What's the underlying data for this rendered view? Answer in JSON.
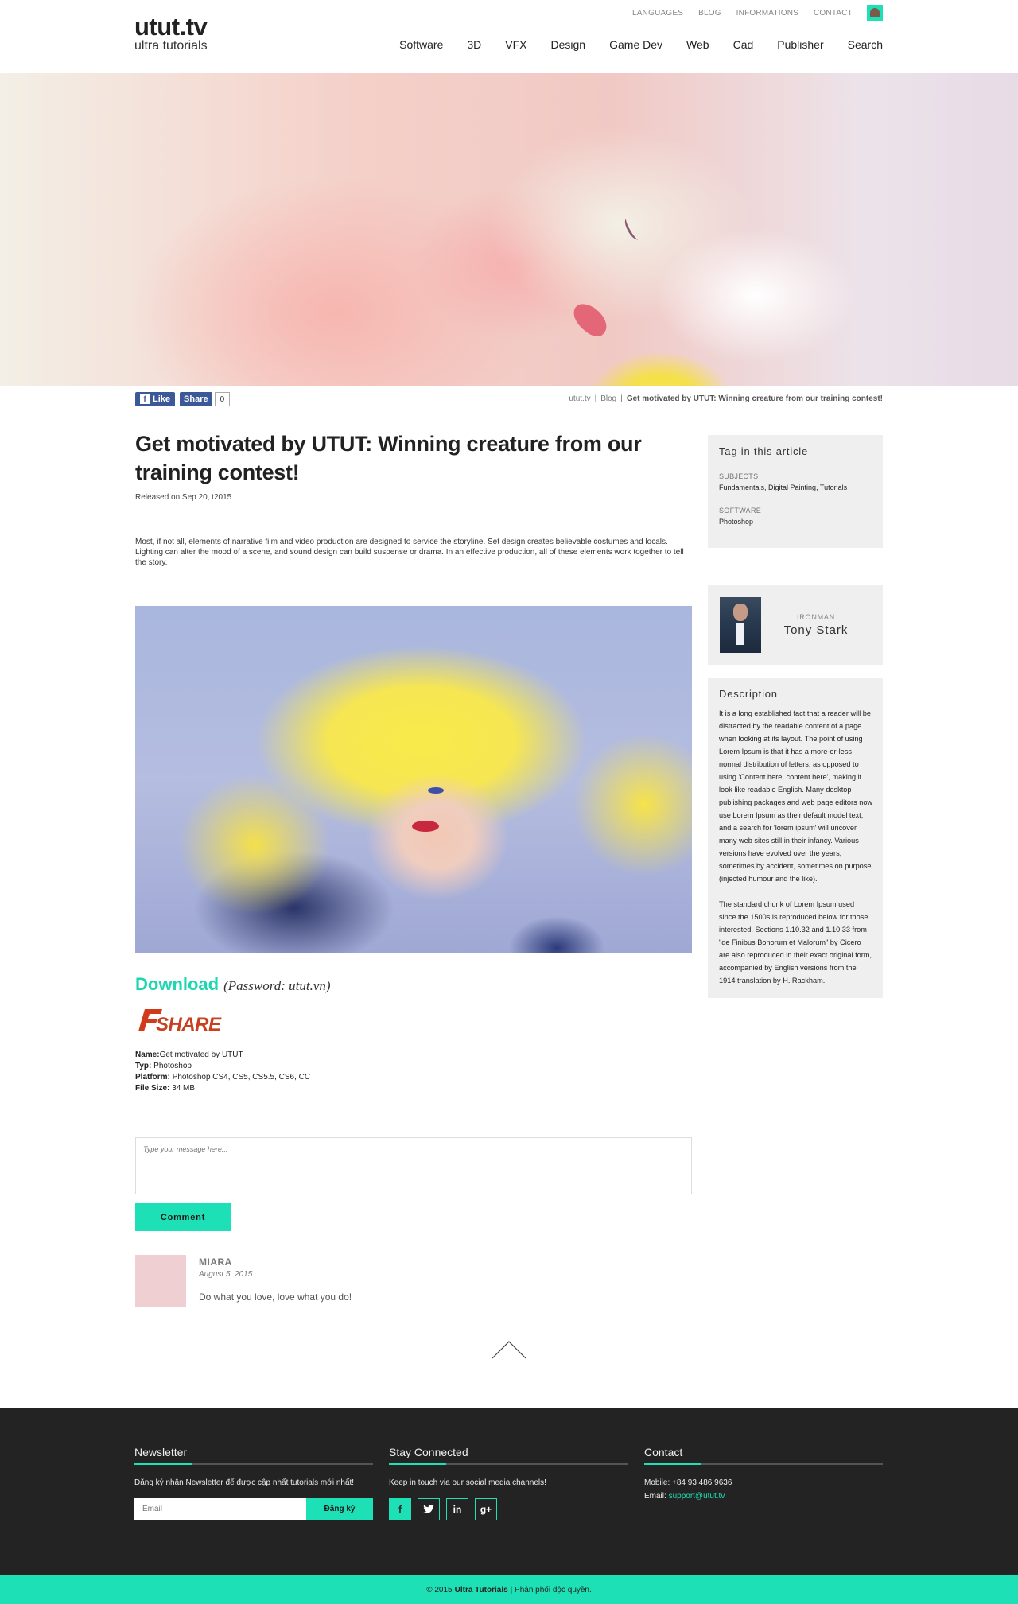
{
  "logo": {
    "title": "utut.tv",
    "subtitle": "ultra tutorials"
  },
  "toplinks": [
    "LANGUAGES",
    "BLOG",
    "INFORMATIONS",
    "CONTACT"
  ],
  "nav": [
    "Software",
    "3D",
    "VFX",
    "Design",
    "Game Dev",
    "Web",
    "Cad",
    "Publisher",
    "Search"
  ],
  "share": {
    "like": "Like",
    "share": "Share",
    "count": "0"
  },
  "breadcrumb": {
    "home": "utut.tv",
    "section": "Blog",
    "current": "Get motivated by UTUT: Winning creature from our training contest!"
  },
  "article": {
    "title": "Get motivated by UTUT: Winning creature from our training contest!",
    "released": "Released on Sep 20, t2015",
    "intro": "Most, if not all, elements of narrative film and video production are designed to service the storyline. Set design creates believable costumes and locals. Lighting can alter the mood of a scene, and sound design can build suspense or drama. In an effective production, all of these elements work together to tell the story.",
    "download": "Download",
    "password": "(Password: utut.vn)",
    "fshare_logo": "FSHARE",
    "meta": {
      "name_label": "Name:",
      "name": "Get motivated by UTUT",
      "type_label": "Typ:",
      "type": "Photoshop",
      "platform_label": "Platform:",
      "platform": "Photoshop CS4, CS5, CS5.5, CS6, CC",
      "size_label": "File Size:",
      "size": "34 MB"
    }
  },
  "comments": {
    "placeholder": "Type your message here...",
    "button": "Comment",
    "items": [
      {
        "name": "MIARA",
        "date": "August 5, 2015",
        "text": "Do what you love, love what you do!"
      }
    ]
  },
  "sidebar": {
    "tags_title": "Tag in this article",
    "subjects_label": "SUBJECTS",
    "subjects": "Fundamentals, Digital Painting, Tutorials",
    "software_label": "SOFTWARE",
    "software": "Photoshop",
    "author_role": "IRONMAN",
    "author_name": "Tony Stark",
    "desc_title": "Description",
    "desc_p1": "It is a long established fact that a reader will be distracted by the readable content of a page when looking at its layout. The point of using Lorem Ipsum is that it has a more-or-less normal distribution of letters, as opposed to using 'Content here, content here', making it look like readable English. Many desktop publishing packages and web page editors now use Lorem Ipsum as their default model text, and a search for 'lorem ipsum' will uncover many web sites still in their infancy. Various versions have evolved over the years, sometimes by accident, sometimes on purpose (injected humour and the like).",
    "desc_p2": "The standard chunk of Lorem Ipsum used since the 1500s is reproduced below for those interested. Sections 1.10.32 and 1.10.33 from \"de Finibus Bonorum et Malorum\" by Cicero are also reproduced in their exact original form, accompanied by English versions from the 1914 translation by H. Rackham."
  },
  "footer": {
    "newsletter_title": "Newsletter",
    "newsletter_text": "Đăng ký nhận Newsletter để được cập nhất tutorials mới nhất!",
    "email_placeholder": "Email",
    "subscribe": "Đăng ký",
    "social_title": "Stay Connected",
    "social_text": "Keep in touch via our social media channels!",
    "socials": [
      "f",
      "t",
      "in",
      "g+"
    ],
    "contact_title": "Contact",
    "mobile_label": "Mobile:",
    "mobile": "+84 93 486 9636",
    "email_label": "Email:",
    "email": "support@utut.tv",
    "copy_prefix": "© 2015",
    "copy_brand": "Ultra Tutorials",
    "copy_suffix": "|  Phân phối độc quyền."
  },
  "colors": {
    "accent": "#1ee0b6",
    "footer_bg": "#232323",
    "facebook": "#3b5998"
  }
}
